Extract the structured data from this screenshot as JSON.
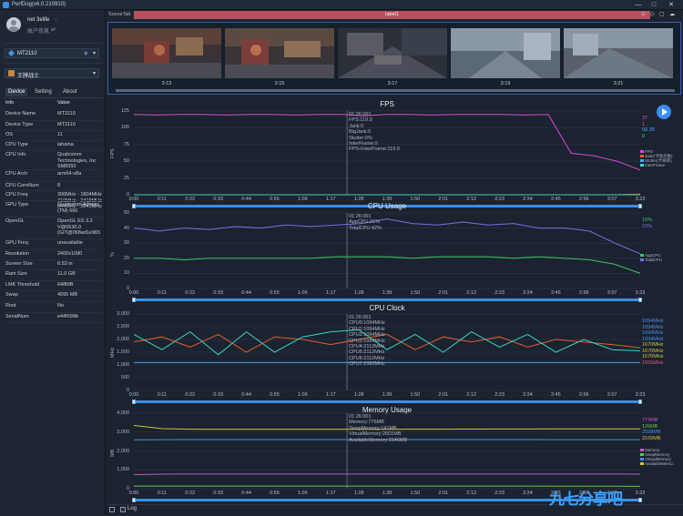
{
  "window": {
    "title": "PerfDog(v6.0.210910)",
    "controls": [
      "—",
      "□",
      "✕"
    ]
  },
  "user": {
    "name": "net 3elife",
    "name_icon": "◌",
    "account": "账户信息",
    "account_icon": "⇄"
  },
  "device_select": {
    "label": "MT2110",
    "extra": "◈"
  },
  "app_select": {
    "label": "王牌战士"
  },
  "left_tabs": [
    "Device",
    "Setting",
    "About"
  ],
  "device_info": {
    "header": {
      "key": "Info",
      "value": "Value"
    },
    "rows": [
      {
        "key": "Device Name",
        "value": "MT2110"
      },
      {
        "key": "Device Type",
        "value": "MT2110"
      },
      {
        "key": "OS",
        "value": "11"
      },
      {
        "key": "CPU Type",
        "value": "lahaina"
      },
      {
        "key": "CPU Info",
        "value": "Qualcomm Technologies, Inc SM8350"
      },
      {
        "key": "CPU Arch",
        "value": "arm64-v8a"
      },
      {
        "key": "CPU CoreNum",
        "value": "8"
      },
      {
        "key": "CPU Freq",
        "value": "300MHz - 1804MHz 710MHz - 2419MHz 844MHz - 2841MHz"
      },
      {
        "key": "GPU Type",
        "value": "Qualcomm Adreno (TM) 660"
      },
      {
        "key": "OpenGL",
        "value": "OpenGL ES 3.2 V@0530.0 (GIT@068ad1e965"
      },
      {
        "key": "GPU Freq",
        "value": "unavailable"
      },
      {
        "key": "Resolution",
        "value": "2400x1080"
      },
      {
        "key": "Screen Size",
        "value": "6.53 in"
      },
      {
        "key": "Ram Size",
        "value": "11.0 GB"
      },
      {
        "key": "LMK Threshold",
        "value": "648MB"
      },
      {
        "key": "Swap",
        "value": "4095 MB"
      },
      {
        "key": "Root",
        "value": "No"
      },
      {
        "key": "SerialNum",
        "value": "e44f099b"
      }
    ]
  },
  "scene_tab": {
    "label": "SceneTab",
    "bar_label": "label1",
    "icons": [
      "⊙",
      "◇",
      "▢",
      "☁"
    ]
  },
  "thumbnails": [
    {
      "time": "3:13"
    },
    {
      "time": "3:15"
    },
    {
      "time": "3:17"
    },
    {
      "time": "3:19"
    },
    {
      "time": "3:21"
    }
  ],
  "x_ticks": [
    "0:00",
    "0:11",
    "0:22",
    "0:33",
    "0:44",
    "0:55",
    "1:06",
    "1:17",
    "1:28",
    "1:39",
    "1:50",
    "2:01",
    "2:12",
    "2:23",
    "2:34",
    "2:45",
    "2:56",
    "3:07",
    "3:23"
  ],
  "colors": {
    "fps": "#e048d8",
    "jank": "#e85c2a",
    "bigjank": "#4aa3ff",
    "stutter": "#3ad3c8",
    "app_cpu": "#3fc46a",
    "total_cpu": "#7a70e6",
    "memory": "#c455c9",
    "swap": "#67c84a",
    "virtual": "#4a8de8",
    "available": "#d8c23a"
  },
  "chart_data": [
    {
      "type": "line",
      "title": "FPS",
      "ylabel": "FPS",
      "ylim": [
        0,
        125
      ],
      "yticks": [
        "125",
        "100",
        "75",
        "50",
        "25",
        "0"
      ],
      "x": [
        "0:00",
        "0:11",
        "0:22",
        "0:33",
        "0:44",
        "0:55",
        "1:06",
        "1:17",
        "1:28",
        "1:39",
        "1:50",
        "2:01",
        "2:12",
        "2:23",
        "2:34",
        "2:45",
        "2:56",
        "3:07",
        "3:14",
        "3:16",
        "3:18",
        "3:20",
        "3:23"
      ],
      "series": [
        {
          "name": "FPS",
          "values": [
            120,
            119,
            120,
            120,
            119,
            120,
            120,
            119,
            120,
            120,
            118,
            120,
            120,
            119,
            120,
            120,
            120,
            119,
            120,
            62,
            58,
            50,
            37
          ]
        },
        {
          "name": "Jank(卡顿次数)",
          "values": [
            0,
            0,
            0,
            0,
            0,
            0,
            0,
            0,
            0,
            0,
            0,
            0,
            0,
            0,
            0,
            0,
            0,
            0,
            0,
            0,
            0,
            0,
            1
          ]
        },
        {
          "name": "Stutter(卡顿率)",
          "values": [
            0,
            0,
            0,
            0,
            0,
            0,
            0,
            0,
            0,
            0,
            0,
            0,
            0,
            0,
            0,
            0,
            0,
            0,
            0,
            0,
            0,
            0,
            0
          ]
        }
      ],
      "readout": [
        "01:26:001",
        "FPS:119.9",
        "Jank:0",
        "BigJank:0",
        "Stutter:0%",
        "InterFrame:0",
        "FPS+InterFrame:119.9"
      ],
      "right_values": [
        "37",
        "1",
        "58.38",
        "0"
      ],
      "legend": [
        "FPS",
        "Jank(卡顿次数)",
        "Stutter(卡顿率)",
        "InterFrame"
      ]
    },
    {
      "type": "line",
      "title": "CPU Usage",
      "ylabel": "%",
      "ylim": [
        0,
        50
      ],
      "yticks": [
        "50",
        "40",
        "30",
        "20",
        "10",
        "0"
      ],
      "x": [
        "0:00",
        "0:11",
        "0:22",
        "0:33",
        "0:44",
        "0:55",
        "1:06",
        "1:17",
        "1:28",
        "1:39",
        "1:50",
        "2:01",
        "2:12",
        "2:23",
        "2:34",
        "2:45",
        "2:56",
        "3:07",
        "3:14",
        "3:18",
        "3:23"
      ],
      "series": [
        {
          "name": "AppCPU",
          "values": [
            20,
            20,
            19,
            20,
            20,
            20,
            20,
            20,
            21,
            21,
            21,
            20,
            21,
            21,
            21,
            20,
            21,
            20,
            19,
            16,
            10
          ]
        },
        {
          "name": "TotalCPU",
          "values": [
            40,
            38,
            40,
            39,
            41,
            40,
            42,
            41,
            42,
            43,
            46,
            43,
            42,
            44,
            42,
            43,
            40,
            40,
            38,
            30,
            23
          ]
        }
      ],
      "readout": [
        "01:26:001",
        "AppCPU:21%",
        "TotalCPU:42%"
      ],
      "right_values": [
        "10%",
        "23%"
      ],
      "legend": [
        "AppCPU",
        "TotalCPU"
      ]
    },
    {
      "type": "line",
      "title": "CPU Clock",
      "ylabel": "MHz",
      "ylim": [
        0,
        3000
      ],
      "yticks": [
        "3,000",
        "2,500",
        "2,000",
        "1,500",
        "1,000",
        "500",
        "0"
      ],
      "x": [
        "0:00",
        "0:11",
        "0:22",
        "0:33",
        "0:44",
        "0:55",
        "1:06",
        "1:17",
        "1:28",
        "1:39",
        "1:50",
        "2:01",
        "2:12",
        "2:23",
        "2:34",
        "2:45",
        "2:56",
        "3:07",
        "3:23"
      ],
      "series": [
        {
          "name": "CPU0",
          "values": [
            1094,
            1094,
            1094,
            1094,
            1094,
            1094,
            1094,
            1094,
            1094,
            1094,
            1094,
            1094,
            1094,
            1094,
            1094,
            1094,
            1094,
            1094,
            1094
          ]
        },
        {
          "name": "CPU4",
          "values": [
            1900,
            2100,
            1700,
            2200,
            1500,
            2100,
            2000,
            1800,
            2000,
            2200,
            1600,
            2100,
            1900,
            2100,
            1700,
            2000,
            1900,
            1800,
            1670
          ]
        },
        {
          "name": "CPU7",
          "values": [
            2200,
            1600,
            2300,
            1400,
            2300,
            1500,
            2100,
            2300,
            2380,
            1600,
            2200,
            1500,
            2300,
            1700,
            2200,
            1500,
            2000,
            1600,
            1555
          ]
        }
      ],
      "readout": [
        "01:26:001",
        "CPU0:1094MHz",
        "CPU1:1094MHz",
        "CPU2:1094MHz",
        "CPU3:1094MHz",
        "CPU4:2112MHz",
        "CPU5:2112MHz",
        "CPU6:2112MHz",
        "CPU7:2380MHz"
      ],
      "right_values": [
        "1094MHz",
        "1094MHz",
        "1094MHz",
        "1094MHz",
        "1670MHz",
        "1670MHz",
        "1670MHz",
        "1555MHz"
      ]
    },
    {
      "type": "line",
      "title": "Memory Usage",
      "ylabel": "MB",
      "ylim": [
        0,
        4000
      ],
      "yticks": [
        "4,000",
        "3,000",
        "2,000",
        "1,000",
        "0"
      ],
      "x": [
        "0:00",
        "0:11",
        "0:22",
        "0:33",
        "0:44",
        "0:55",
        "1:06",
        "1:17",
        "1:28",
        "1:39",
        "1:50",
        "2:01",
        "2:12",
        "2:23",
        "2:34",
        "2:45",
        "2:56",
        "3:07",
        "3:23"
      ],
      "series": [
        {
          "name": "Memory",
          "values": [
            740,
            770,
            775,
            776,
            776,
            776,
            776,
            776,
            776,
            776,
            776,
            776,
            776,
            776,
            776,
            776,
            776,
            774,
            773
          ]
        },
        {
          "name": "SwapMemory",
          "values": [
            141,
            141,
            141,
            141,
            141,
            141,
            141,
            141,
            141,
            141,
            141,
            140,
            140,
            138,
            138,
            136,
            134,
            130,
            126
          ]
        },
        {
          "name": "VirtualMemory",
          "values": [
            2590,
            2600,
            2601,
            2601,
            2601,
            2601,
            2601,
            2601,
            2601,
            2601,
            2601,
            2601,
            2601,
            2601,
            2601,
            2600,
            2600,
            2599,
            2598
          ]
        },
        {
          "name": "AvailableMemory",
          "values": [
            3350,
            3180,
            3150,
            3148,
            3146,
            3146,
            3146,
            3146,
            3146,
            3146,
            3150,
            3152,
            3155,
            3160,
            3162,
            3165,
            3166,
            3168,
            3169
          ]
        }
      ],
      "readout": [
        "01:26:001",
        "Memory:776MB",
        "SwapMemory:141MB",
        "VirtualMemory:2601MB",
        "AvailableMemory:3146MB"
      ],
      "right_values": [
        "773MB",
        "126MB",
        "2598MB",
        "3169MB"
      ],
      "legend": [
        "Memory",
        "SwapMemory",
        "VirtualMemory",
        "AvailableMemo.."
      ]
    }
  ],
  "bottom": {
    "log_label": "Log"
  },
  "watermark": "九七分享吧"
}
